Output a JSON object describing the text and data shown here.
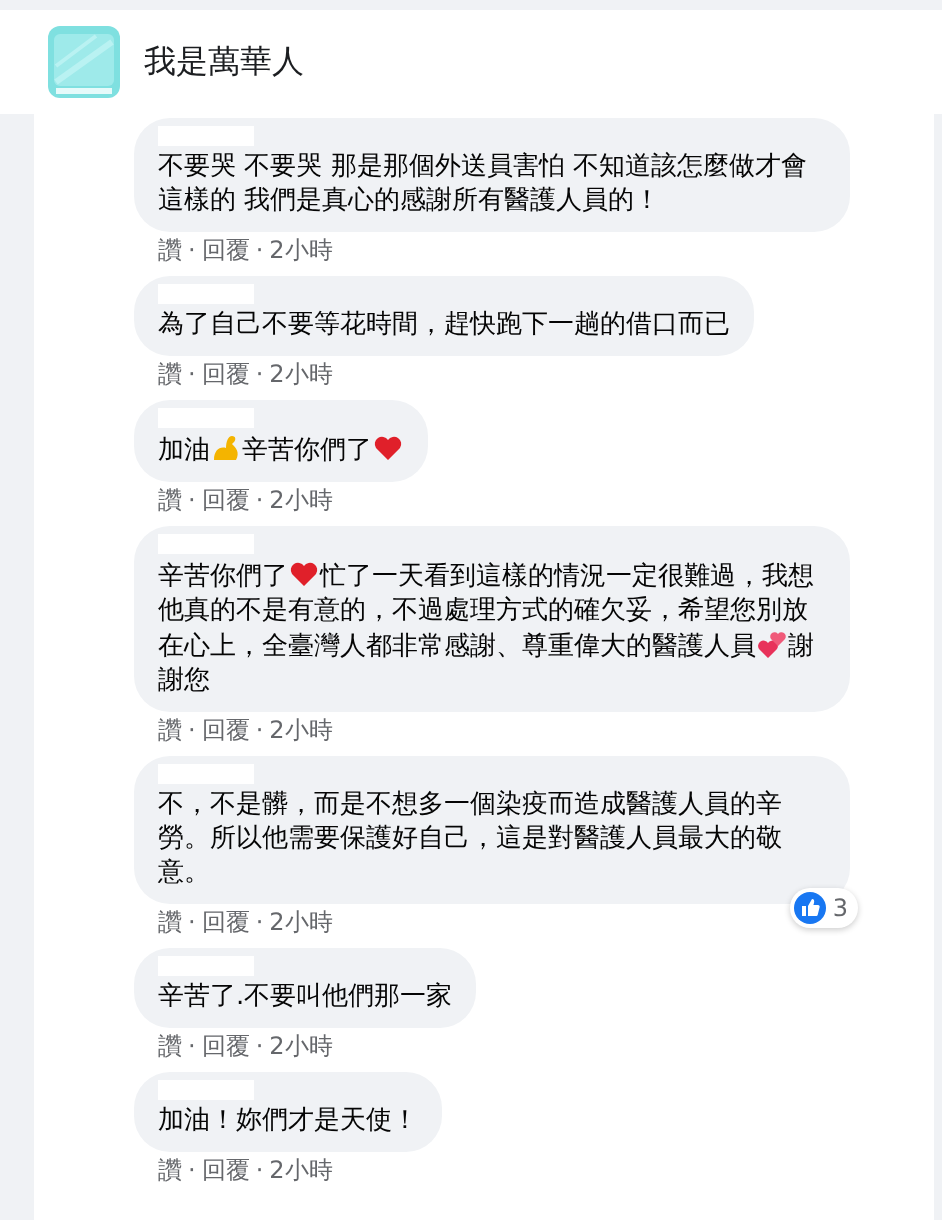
{
  "header": {
    "title": "我是萬華人"
  },
  "separator": "·",
  "comments": [
    {
      "parts": [
        {
          "kind": "text",
          "text": "不要哭 不要哭 那是那個外送員害怕 不知道該怎麼做才會這樣的 我們是真心的感謝所有醫護人員的！"
        }
      ],
      "actions": [
        "讚",
        "回覆",
        "2小時"
      ]
    },
    {
      "parts": [
        {
          "kind": "text",
          "text": "為了自己不要等花時間，趕快跑下一趟的借口而已"
        }
      ],
      "actions": [
        "讚",
        "回覆",
        "2小時"
      ]
    },
    {
      "parts": [
        {
          "kind": "text",
          "text": "加油"
        },
        {
          "kind": "flexed-arm"
        },
        {
          "kind": "text",
          "text": "辛苦你們了"
        },
        {
          "kind": "heart"
        }
      ],
      "actions": [
        "讚",
        "回覆",
        "2小時"
      ]
    },
    {
      "parts": [
        {
          "kind": "text",
          "text": "辛苦你們了"
        },
        {
          "kind": "heart"
        },
        {
          "kind": "text",
          "text": "忙了一天看到這樣的情況一定很難過，我想他真的不是有意的，不過處理方式的確欠妥，希望您別放在心上，全臺灣人都非常感謝、尊重偉大的醫護人員"
        },
        {
          "kind": "two-hearts"
        },
        {
          "kind": "text",
          "text": "謝謝您"
        }
      ],
      "actions": [
        "讚",
        "回覆",
        "2小時"
      ]
    },
    {
      "parts": [
        {
          "kind": "text",
          "text": "不，不是髒，而是不想多一個染疫而造成醫護人員的辛勞。所以他需要保護好自己，這是對醫護人員最大的敬意。"
        }
      ],
      "actions": [
        "讚",
        "回覆",
        "2小時"
      ],
      "reaction": {
        "count": "3"
      }
    },
    {
      "parts": [
        {
          "kind": "text",
          "text": "辛苦了.不要叫他們那一家"
        }
      ],
      "actions": [
        "讚",
        "回覆",
        "2小時"
      ]
    },
    {
      "parts": [
        {
          "kind": "text",
          "text": "加油！妳們才是天使！"
        }
      ],
      "actions": [
        "讚",
        "回覆",
        "2小時"
      ]
    }
  ]
}
